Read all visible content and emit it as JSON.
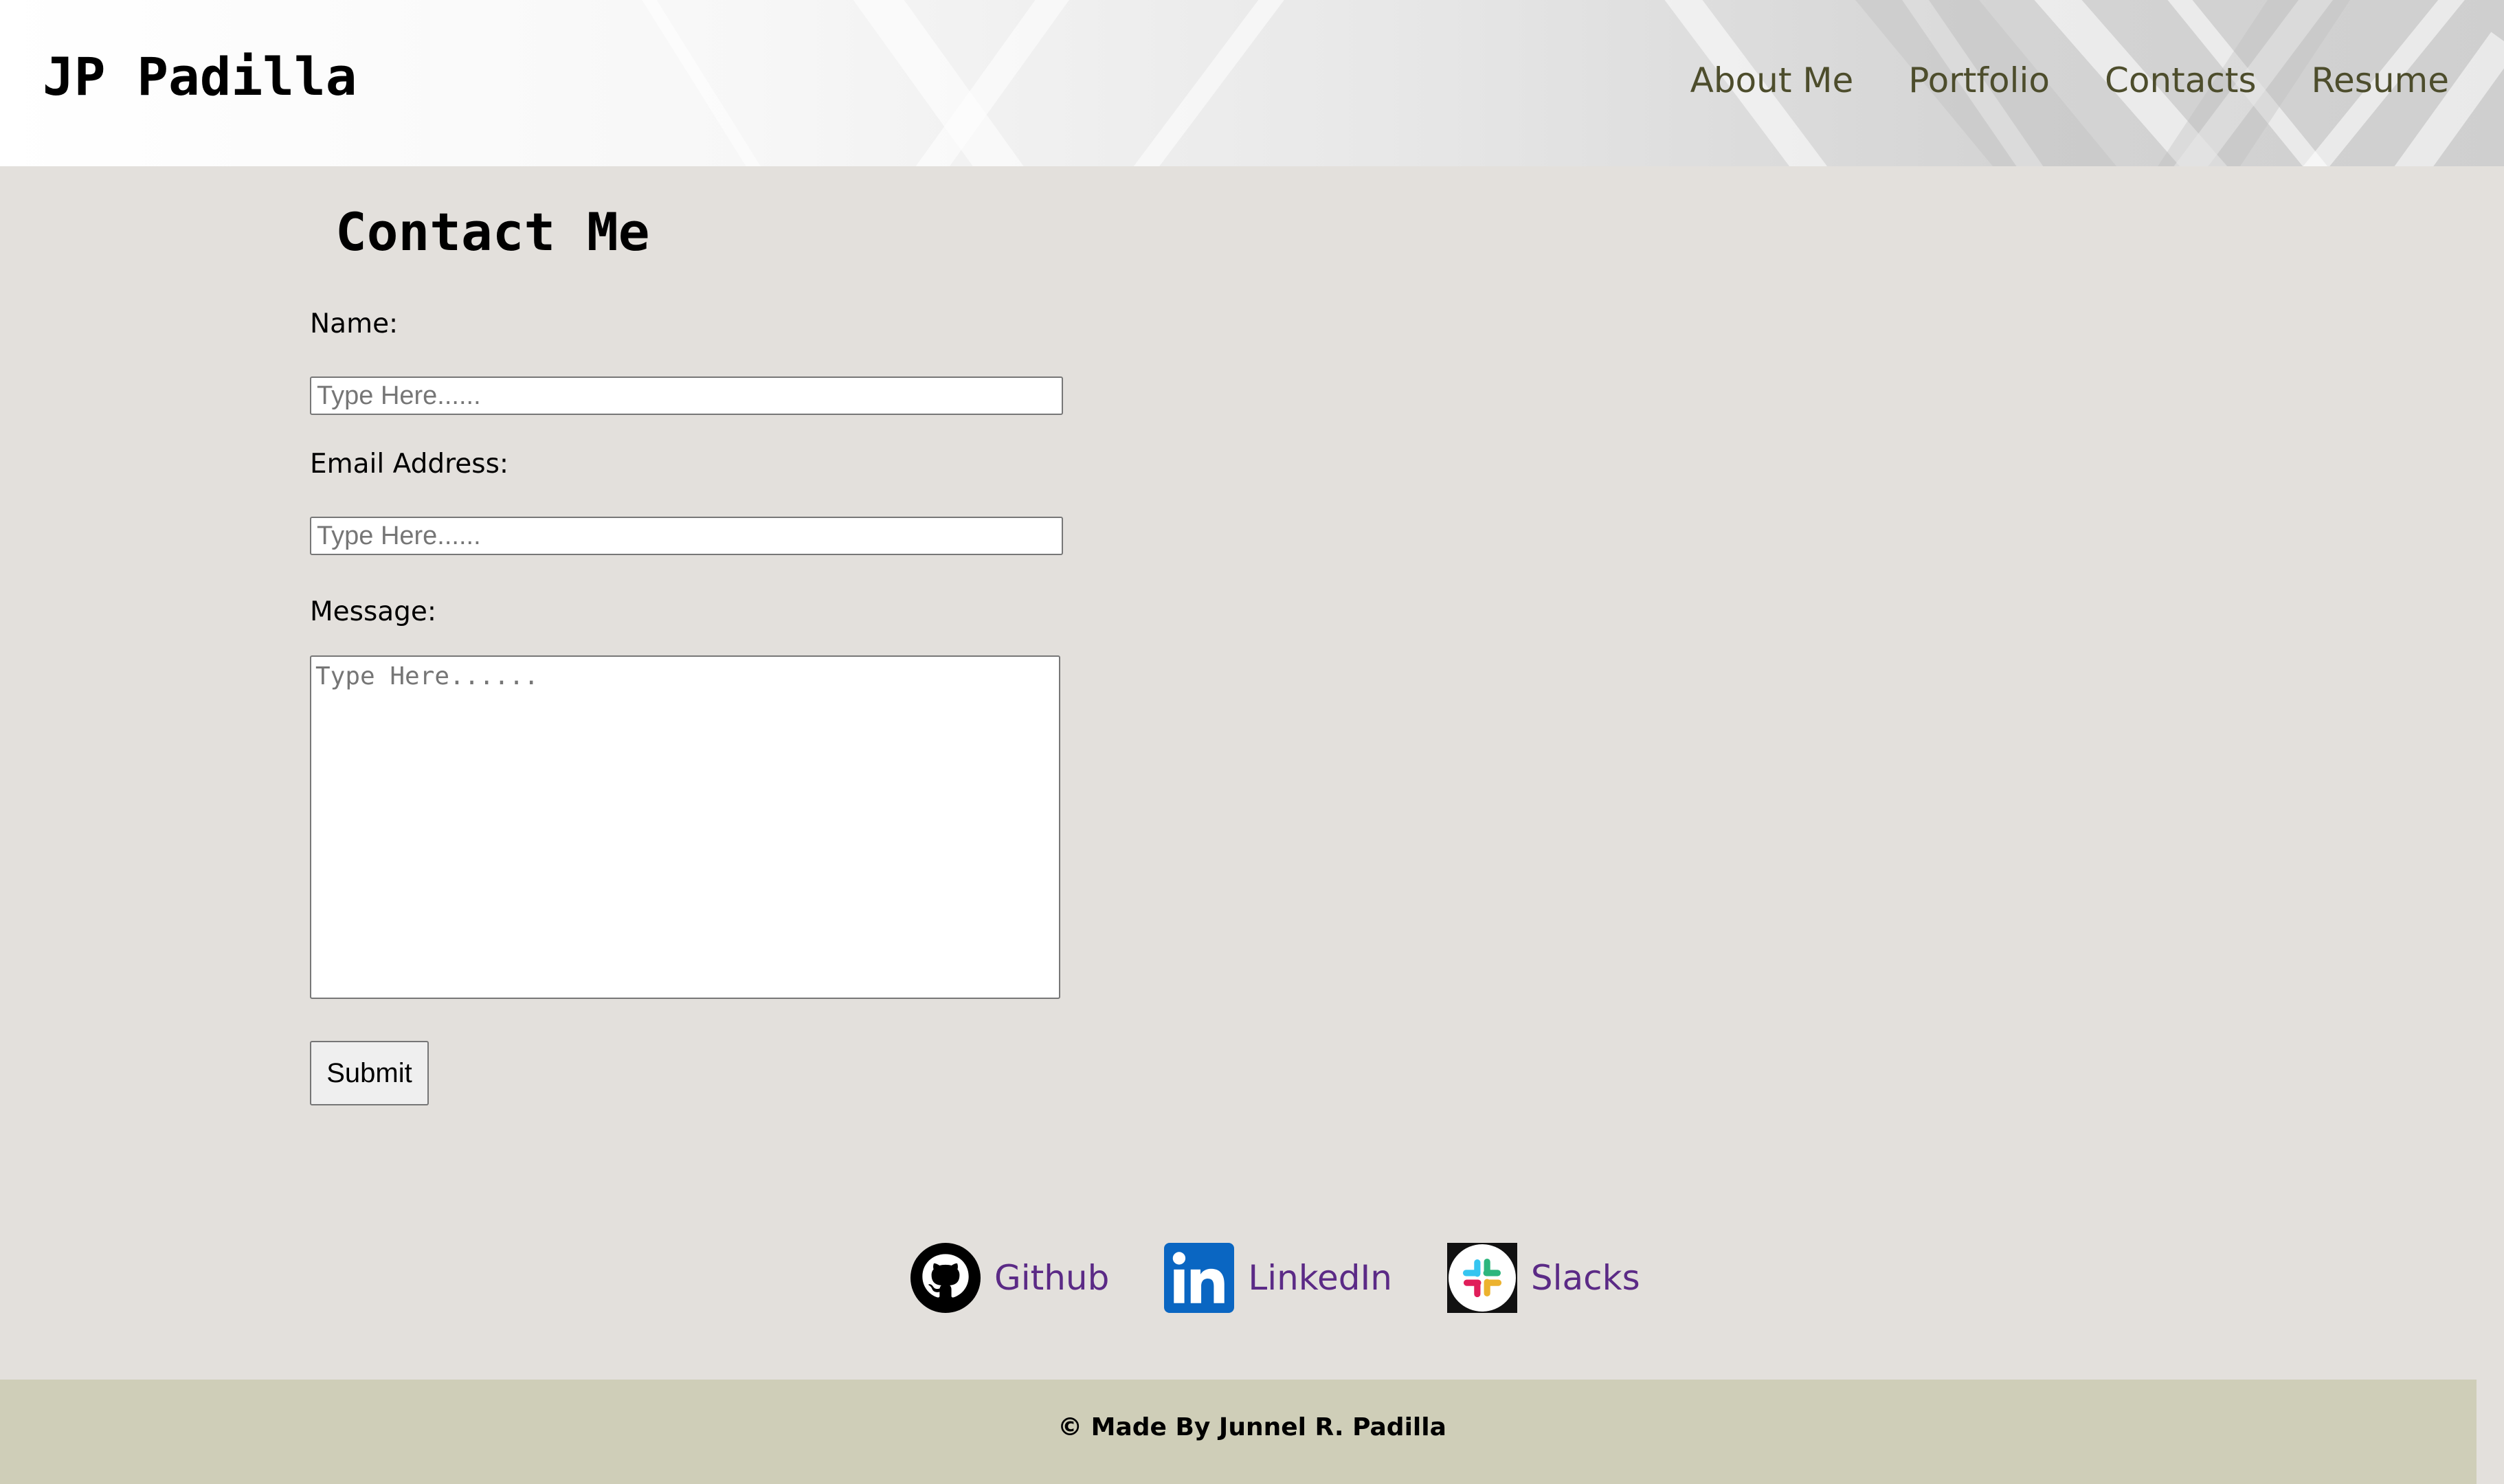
{
  "header": {
    "brand": "JP Padilla",
    "nav": [
      {
        "label": "About Me"
      },
      {
        "label": "Portfolio"
      },
      {
        "label": "Contacts"
      },
      {
        "label": "Resume"
      }
    ]
  },
  "contact": {
    "title": "Contact Me",
    "name_label": "Name:",
    "name_placeholder": "Type Here......",
    "name_value": "",
    "email_label": "Email Address:",
    "email_placeholder": "Type Here......",
    "email_value": "",
    "message_label": "Message:",
    "message_placeholder": "Type Here......",
    "message_value": "",
    "submit_label": "Submit"
  },
  "social": [
    {
      "label": "Github",
      "icon": "github-icon"
    },
    {
      "label": "LinkedIn",
      "icon": "linkedin-icon"
    },
    {
      "label": "Slacks",
      "icon": "slack-icon"
    }
  ],
  "footer": {
    "text": "© Made By Junnel R. Padilla"
  },
  "colors": {
    "page_background": "#e3e0dc",
    "footer_background": "#cfceb8",
    "nav_link": "#4d4d2c",
    "social_link": "#5b2a86",
    "linkedin_blue": "#0a66c2"
  }
}
